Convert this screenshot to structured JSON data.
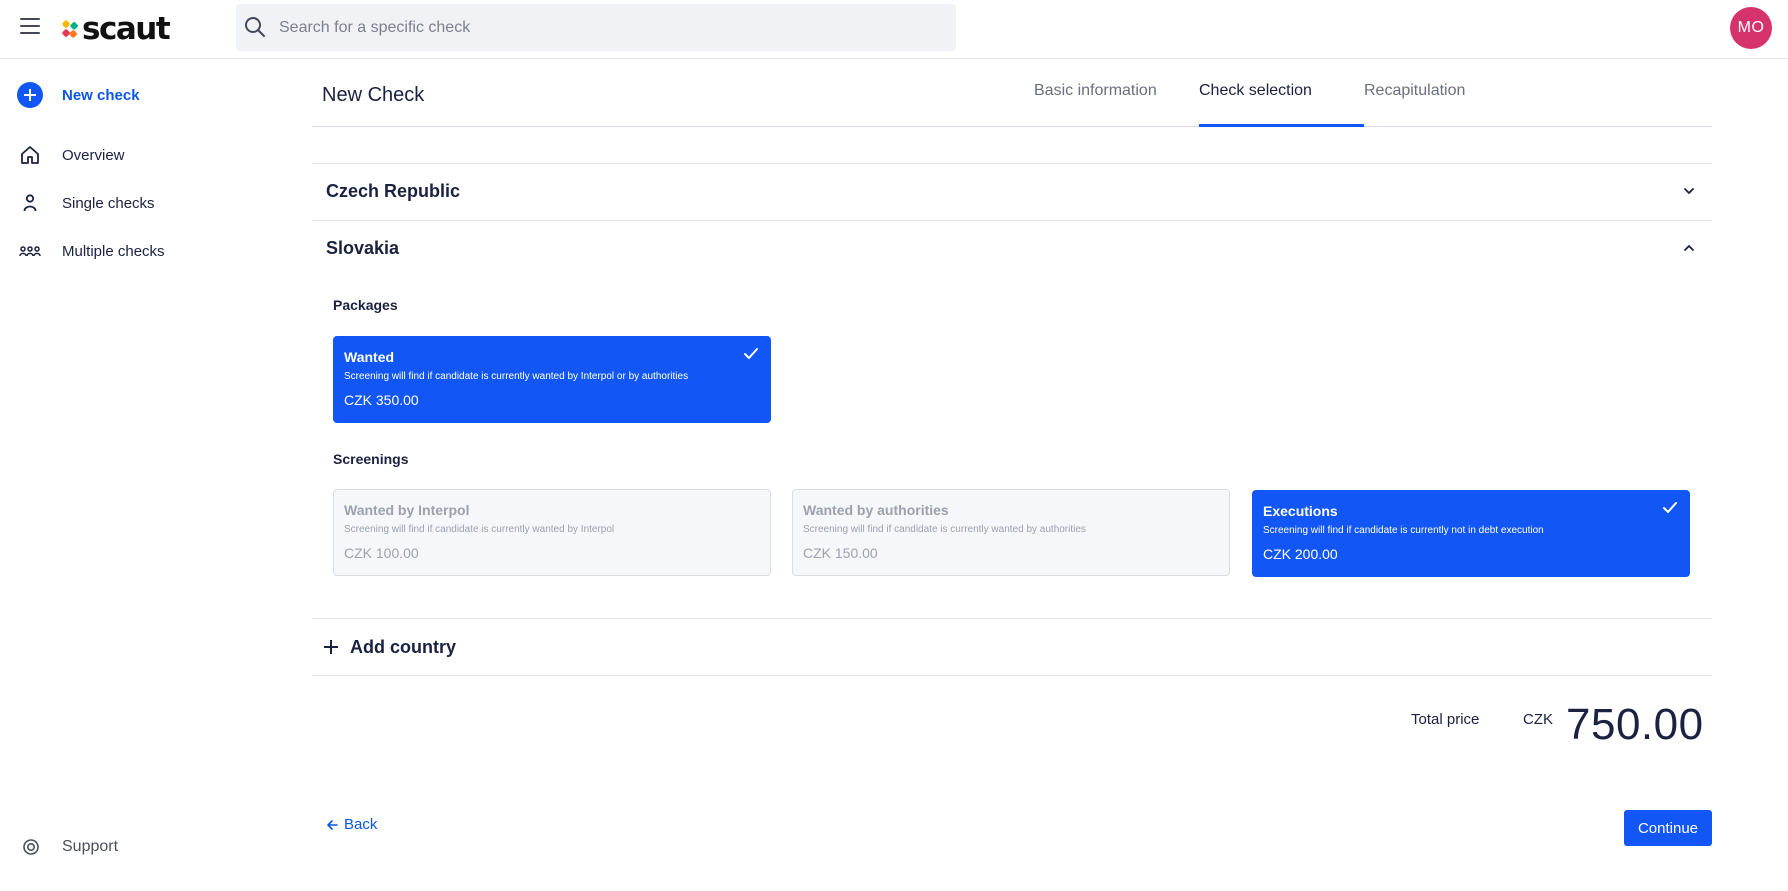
{
  "header": {
    "logo_text": "scaut",
    "search_placeholder": "Search for a specific check",
    "avatar_initials": "MO"
  },
  "sidebar": {
    "new_check": "New check",
    "items": [
      {
        "label": "Overview",
        "icon": "home-icon"
      },
      {
        "label": "Single checks",
        "icon": "person-icon"
      },
      {
        "label": "Multiple checks",
        "icon": "group-icon"
      }
    ],
    "support": "Support"
  },
  "page": {
    "title": "New Check",
    "tabs": [
      {
        "label": "Basic information",
        "active": false
      },
      {
        "label": "Check selection",
        "active": true
      },
      {
        "label": "Recapitulation",
        "active": false
      }
    ]
  },
  "countries": [
    {
      "name": "Czech Republic",
      "expanded": false
    },
    {
      "name": "Slovakia",
      "expanded": true
    }
  ],
  "slovakia": {
    "packages_label": "Packages",
    "packages": [
      {
        "title": "Wanted",
        "desc": "Screening will find if candidate is currently wanted by Interpol or by authorities",
        "price": "CZK 350.00",
        "state": "selected"
      }
    ],
    "screenings_label": "Screenings",
    "screenings": [
      {
        "title": "Wanted by Interpol",
        "desc": "Screening will find if candidate is currently wanted by Interpol",
        "price": "CZK 100.00",
        "state": "disabled"
      },
      {
        "title": "Wanted by authorities",
        "desc": "Screening will find if candidate is currently wanted by authorities",
        "price": "CZK 150.00",
        "state": "disabled"
      },
      {
        "title": "Executions",
        "desc": "Screening will find if candidate is currently not in debt execution",
        "price": "CZK 200.00",
        "state": "selected"
      }
    ]
  },
  "add_country": "Add country",
  "total": {
    "label": "Total price",
    "currency": "CZK",
    "value": "750.00"
  },
  "actions": {
    "back": "Back",
    "continue": "Continue"
  },
  "colors": {
    "accent": "#1257f5",
    "avatar": "#d6336c",
    "disabled_bg": "#f5f7fa"
  }
}
